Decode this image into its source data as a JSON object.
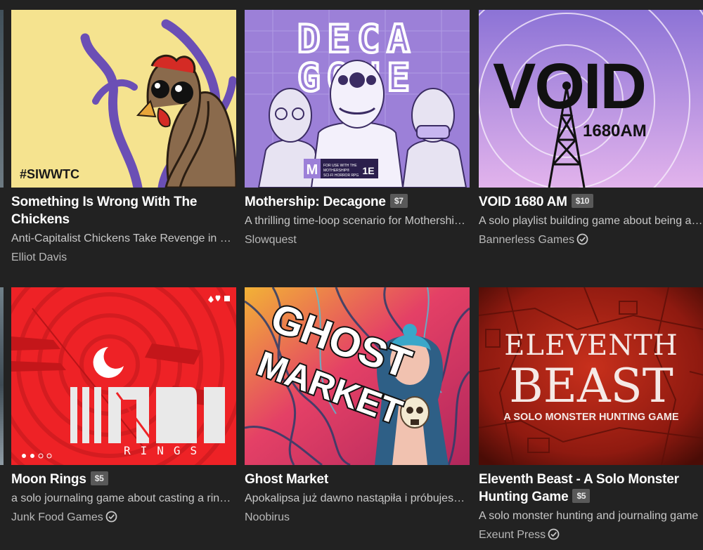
{
  "games": [
    {
      "title": "Something Is Wrong With The Chickens",
      "price": "",
      "description": "Anti-Capitalist Chickens Take Revenge in a Solo Journaling Horror Game",
      "author": "Elliot Davis",
      "verified": false,
      "cover_text": "#SIWWTC"
    },
    {
      "title": "Mothership: Decagone",
      "price": "$7",
      "description": "A thrilling time-loop scenario for Mothership RPG",
      "author": "Slowquest",
      "verified": false,
      "cover_text": "DECA GONE",
      "cover_badge": "FOR USE WITH THE MOTHERSHIP® SCI-FI HORROR RPG",
      "cover_edition": "1E"
    },
    {
      "title": "VOID 1680 AM",
      "price": "$10",
      "description": "A solo playlist building game about being a late night radio host",
      "author": "Bannerless Games",
      "verified": true,
      "cover_text": "VOID",
      "cover_subtext": "1680AM"
    },
    {
      "title": "Moon Rings",
      "price": "$5",
      "description": "a solo journaling game about casting a ring of moons",
      "author": "Junk Food Games",
      "verified": true,
      "cover_text": "RINGS"
    },
    {
      "title": "Ghost Market",
      "price": "",
      "description": "Apokalipsa już dawno nastąpiła i próbujesz przetrwać",
      "author": "Noobirus",
      "verified": false,
      "cover_text": "GHOST MARKET"
    },
    {
      "title": "Eleventh Beast - A Solo Monster Hunting Game",
      "price": "$5",
      "description": "A solo monster hunting and journaling game",
      "author": "Exeunt Press",
      "verified": true,
      "cover_text": "ELEVENTH",
      "cover_text2": "BEAST",
      "cover_subtext": "A SOLO MONSTER HUNTING GAME"
    }
  ],
  "colors": {
    "background": "#222222",
    "price_badge": "#595959",
    "chickens_bg": "#f5e38f",
    "decagone_bg": "#9c80d8",
    "void_bg": "#c9a1e6",
    "moon_bg": "#ee2226",
    "ghost_bg": "#d8345e",
    "beast_bg": "#9c1d13"
  }
}
